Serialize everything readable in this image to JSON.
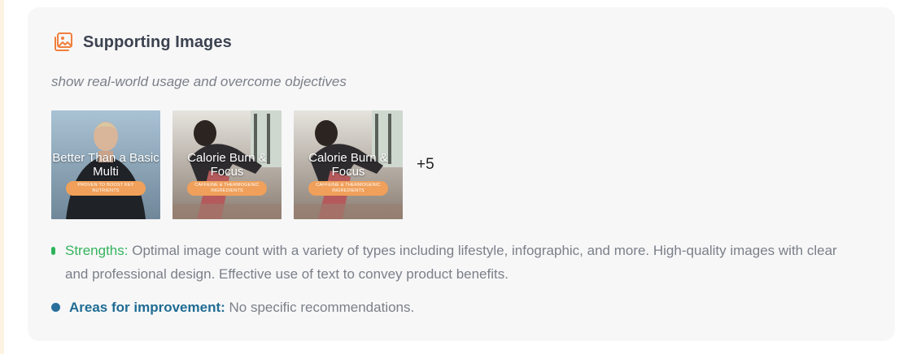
{
  "colors": {
    "accent": "#f07f3c",
    "strength": "#34b45d",
    "improvement": "#1f6c93",
    "card_bg": "#f7f7f8"
  },
  "section": {
    "icon": "image-gallery-icon",
    "title": "Supporting Images",
    "subtitle": "show real-world usage and overcome objectives"
  },
  "images": [
    {
      "title": "Better Than a Basic Multi",
      "pill": "PROVEN TO BOOST KEY NUTRIENTS"
    },
    {
      "title": "Calorie Burn & Focus",
      "pill": "CAFFEINE & THERMOGENIC INGREDIENTS"
    },
    {
      "title": "Calorie Burn & Focus",
      "pill": "CAFFEINE & THERMOGENIC INGREDIENTS"
    }
  ],
  "more_count": "+5",
  "strengths": {
    "label": "Strengths:",
    "text": "Optimal image count with a variety of types including lifestyle, infographic, and more. High-quality images with clear and professional design. Effective use of text to convey product benefits."
  },
  "improvement": {
    "label": "Areas for improvement:",
    "text": "No specific recommendations."
  }
}
